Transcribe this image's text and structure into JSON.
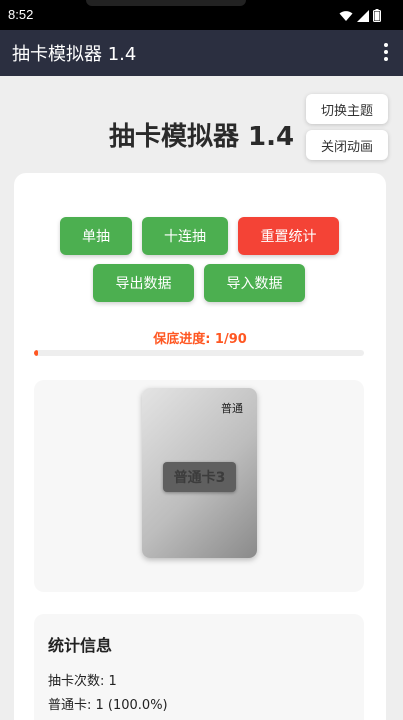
{
  "status_bar": {
    "time": "8:52"
  },
  "app_bar": {
    "title": "抽卡模拟器 1.4"
  },
  "side_buttons": {
    "theme": "切换主题",
    "animation": "关闭动画"
  },
  "page": {
    "title": "抽卡模拟器 1.4"
  },
  "actions": {
    "single": "单抽",
    "ten": "十连抽",
    "reset": "重置统计",
    "export": "导出数据",
    "import": "导入数据"
  },
  "pity": {
    "label": "保底进度: 1/90",
    "current": 1,
    "max": 90
  },
  "card": {
    "rarity": "普通",
    "name": "普通卡3"
  },
  "stats": {
    "title": "统计信息",
    "draw_count": "抽卡次数: 1",
    "common_count": "普通卡: 1 (100.0%)"
  },
  "colors": {
    "accent_green": "#4caf50",
    "danger_red": "#f44336",
    "pity_orange": "#ff5722",
    "app_bar": "#2b2f40"
  },
  "icons": {
    "status": [
      "wifi-icon",
      "signal-icon",
      "battery-icon"
    ],
    "menu": "more-vert-icon"
  }
}
